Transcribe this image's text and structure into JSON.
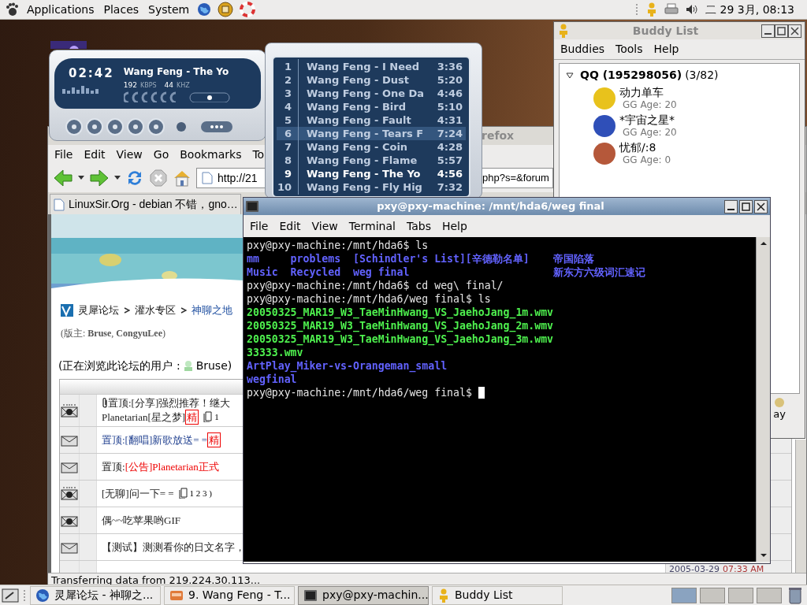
{
  "top_panel": {
    "menus": [
      "Applications",
      "Places",
      "System"
    ],
    "clock": "二 29 3月, 08:13"
  },
  "player": {
    "time": "02:42",
    "song": "Wang Feng - The Yo",
    "bitrate": "192",
    "bitrate_unit": "KBPS",
    "frequency": "44",
    "frequency_unit": "KHZ"
  },
  "playlist": {
    "tracks": [
      {
        "number": "1",
        "title": "Wang Feng - I Need",
        "duration": "3:36",
        "selected": false,
        "playing": false
      },
      {
        "number": "2",
        "title": "Wang Feng - Dust",
        "duration": "5:20",
        "selected": false,
        "playing": false
      },
      {
        "number": "3",
        "title": "Wang Feng - One Da",
        "duration": "4:46",
        "selected": false,
        "playing": false
      },
      {
        "number": "4",
        "title": "Wang Feng - Bird",
        "duration": "5:10",
        "selected": false,
        "playing": false
      },
      {
        "number": "5",
        "title": "Wang Feng - Fault",
        "duration": "4:31",
        "selected": false,
        "playing": false
      },
      {
        "number": "6",
        "title": "Wang Feng - Tears F",
        "duration": "7:24",
        "selected": true,
        "playing": false
      },
      {
        "number": "7",
        "title": "Wang Feng - Coin",
        "duration": "4:28",
        "selected": false,
        "playing": false
      },
      {
        "number": "8",
        "title": "Wang Feng - Flame",
        "duration": "5:57",
        "selected": false,
        "playing": false
      },
      {
        "number": "9",
        "title": "Wang Feng - The Yo",
        "duration": "4:56",
        "selected": false,
        "playing": true
      },
      {
        "number": "10",
        "title": "Wang Feng - Fly Hig",
        "duration": "7:32",
        "selected": false,
        "playing": false
      }
    ]
  },
  "browser": {
    "title": "refox",
    "menu": [
      "File",
      "Edit",
      "View",
      "Go",
      "Bookmarks",
      "To"
    ],
    "address_start": "http://21",
    "address_end": "php?s=&forum",
    "tab": "LinuxSir.Org - debian 不错，gno…",
    "breadcrumb": [
      "灵犀论坛",
      "灌水专区",
      "神聊之地"
    ],
    "moderators": "(版主: **Bruse**, **CongyuLee**)",
    "viewers_label": "(正在浏览此论坛的用户 :",
    "viewer": "Bruse)",
    "threads": [
      {
        "kind": "hot",
        "attachment": true,
        "segments": [
          {
            "kind": "text",
            "text": "置顶:[分享]强烈推荐！继大"
          },
          {
            "kind": "break"
          },
          {
            "kind": "text",
            "text": "Planetarian[星之梦]"
          },
          {
            "kind": "elite",
            "text": "精"
          },
          {
            "kind": "pages",
            "text": "1"
          }
        ]
      },
      {
        "kind": "normal",
        "attachment": false,
        "segments": [
          {
            "kind": "text",
            "text": "置顶:[翻唱]新歌放送= ="
          },
          {
            "kind": "elite",
            "text": "精"
          }
        ]
      },
      {
        "kind": "normal",
        "attachment": false,
        "segments": [
          {
            "kind": "text",
            "text": "置顶:"
          },
          {
            "kind": "alert",
            "text": "[公告]Planetarian正式"
          }
        ]
      },
      {
        "kind": "hot",
        "attachment": false,
        "segments": [
          {
            "kind": "text",
            "text": "[无聊]问一下= ="
          },
          {
            "kind": "pages",
            "text": "1 2 3 )"
          }
        ]
      },
      {
        "kind": "new",
        "attachment": false,
        "segments": [
          {
            "kind": "text",
            "text": "偶~~吃苹果哟GIF"
          }
        ]
      },
      {
        "kind": "normal",
        "attachment": false,
        "segments": [
          {
            "kind": "text",
            "text": "【测试】测测看你的日文名字，"
          }
        ]
      }
    ],
    "last_post_date": "2005-03-29",
    "last_post_time": "07:33 AM",
    "status": "Transferring data from 219.224.30.113..."
  },
  "buddy_list": {
    "title": "Buddy List",
    "menu": [
      "Buddies",
      "Tools",
      "Help"
    ],
    "group": {
      "name": "QQ (195298056)",
      "count": "(3/82)",
      "expanded": true
    },
    "buddies": [
      {
        "name": "动力单车",
        "info": "GG Age: 20",
        "color": "#e8c21c"
      },
      {
        "name": "*宇宙之星*",
        "info": "GG Age: 20",
        "color": "#2f4fb8"
      },
      {
        "name": "忧郁/:8",
        "info": "GG Age: 0",
        "color": "#b5583a"
      }
    ],
    "away_button": "ay"
  },
  "terminal": {
    "title": "pxy@pxy-machine: /mnt/hda6/weg final",
    "menu": [
      "File",
      "Edit",
      "View",
      "Terminal",
      "Tabs",
      "Help"
    ],
    "lines": [
      {
        "kind": "prompt",
        "text": "pxy@pxy-machine:/mnt/hda6$ ls"
      },
      {
        "kind": "listing",
        "entries": [
          {
            "name": "mm",
            "kind": "dir"
          },
          {
            "name": "problems",
            "kind": "dir"
          },
          {
            "name": "[Schindler's List][辛德勒名单]",
            "kind": "dir"
          },
          {
            "name": "帝国陷落",
            "kind": "dir"
          }
        ]
      },
      {
        "kind": "listing",
        "entries": [
          {
            "name": "Music",
            "kind": "dir"
          },
          {
            "name": "Recycled",
            "kind": "dir"
          },
          {
            "name": "weg final",
            "kind": "dir"
          },
          {
            "name": "新东方六级词汇速记",
            "kind": "dir"
          }
        ]
      },
      {
        "kind": "prompt",
        "text": "pxy@pxy-machine:/mnt/hda6$ cd weg\\ final/"
      },
      {
        "kind": "prompt",
        "text": "pxy@pxy-machine:/mnt/hda6/weg final$ ls"
      },
      {
        "kind": "listing",
        "entries": [
          {
            "name": "20050325_MAR19_W3_TaeMinHwang_VS_JaehoJang_1m.wmv",
            "kind": "media"
          }
        ]
      },
      {
        "kind": "listing",
        "entries": [
          {
            "name": "20050325_MAR19_W3_TaeMinHwang_VS_JaehoJang_2m.wmv",
            "kind": "media"
          }
        ]
      },
      {
        "kind": "listing",
        "entries": [
          {
            "name": "20050325_MAR19_W3_TaeMinHwang_VS_JaehoJang_3m.wmv",
            "kind": "media"
          }
        ]
      },
      {
        "kind": "listing",
        "entries": [
          {
            "name": "33333.wmv",
            "kind": "media"
          }
        ]
      },
      {
        "kind": "listing",
        "entries": [
          {
            "name": "ArtPlay_Miker-vs-Orangeman_small",
            "kind": "dir"
          }
        ]
      },
      {
        "kind": "listing",
        "entries": [
          {
            "name": "wegfinal",
            "kind": "dir"
          }
        ]
      },
      {
        "kind": "prompt",
        "text": "pxy@pxy-machine:/mnt/hda6/weg final$",
        "cursor": true
      }
    ]
  },
  "taskbar": {
    "tasks": [
      {
        "label": "灵犀论坛 - 神聊之...",
        "selected": false
      },
      {
        "label": "9. Wang Feng - T...",
        "selected": false
      },
      {
        "label": "pxy@pxy-machin...",
        "selected": true
      },
      {
        "label": "Buddy List",
        "selected": false
      }
    ],
    "workspaces": [
      {
        "selected": true
      },
      {
        "selected": false
      },
      {
        "selected": false
      },
      {
        "selected": false
      }
    ]
  }
}
